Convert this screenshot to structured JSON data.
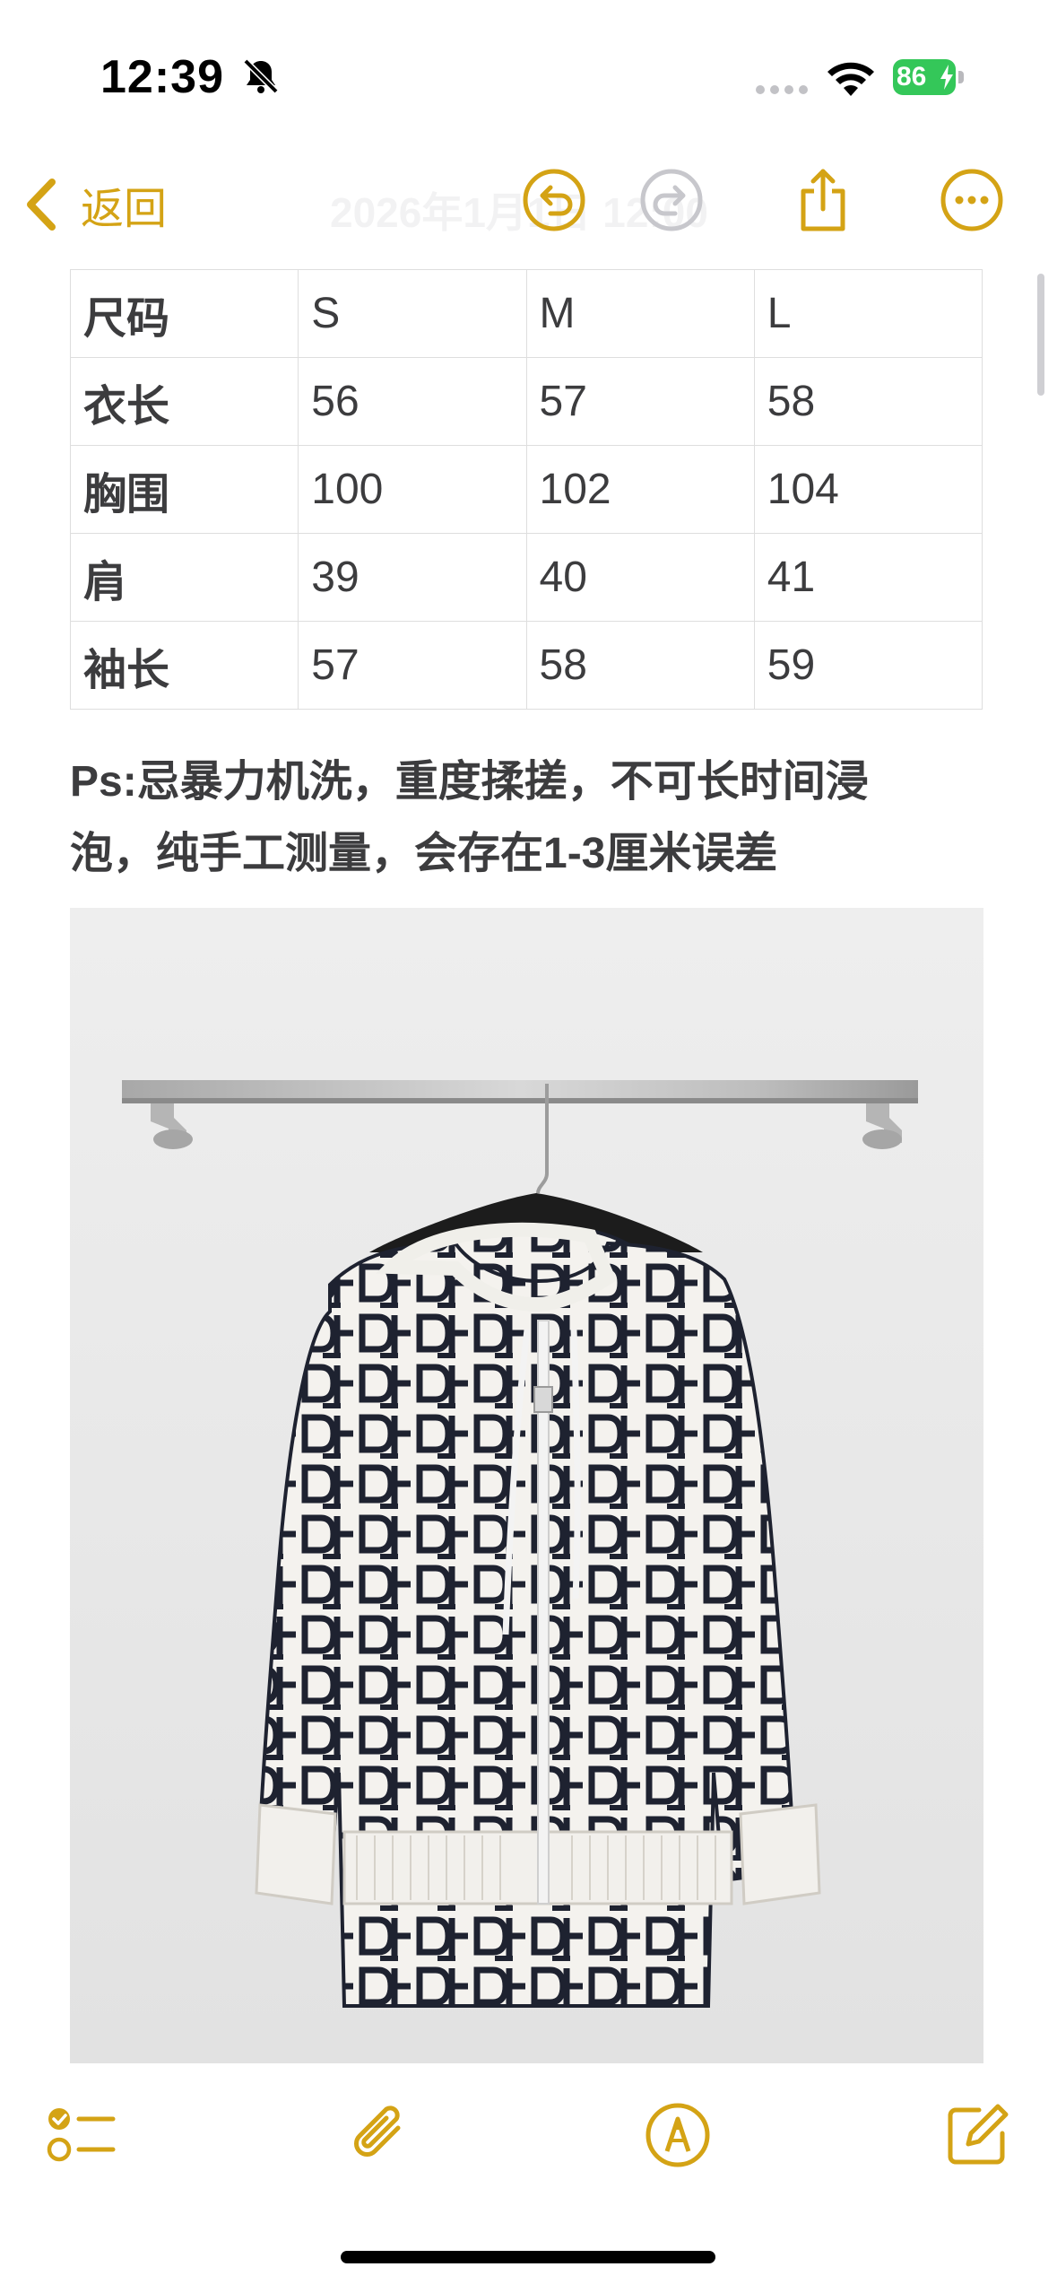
{
  "status_bar": {
    "time": "12:39",
    "battery_percent": "86",
    "icons": [
      "bell-slash-icon",
      "cellular-dots-icon",
      "wifi-icon",
      "battery-charging-icon"
    ]
  },
  "nav": {
    "back_label": "返回",
    "title_faded": "2026年1月1日 12:00",
    "buttons": [
      "undo-icon",
      "redo-icon",
      "share-icon",
      "more-icon"
    ]
  },
  "size_table": {
    "rows": [
      [
        "尺码",
        "S",
        "M",
        "L"
      ],
      [
        "衣长",
        "56",
        "57",
        "58"
      ],
      [
        "胸围",
        "100",
        "102",
        "104"
      ],
      [
        "肩",
        "39",
        "40",
        "41"
      ],
      [
        "袖长",
        "57",
        "58",
        "59"
      ]
    ]
  },
  "note": {
    "line1": "Ps:忌暴力机洗，重度揉搓，不可长时间浸",
    "line2": "泡，纯手工测量，会存在1-3厘米误差"
  },
  "toolbar": {
    "buttons": [
      "checklist-icon",
      "paperclip-icon",
      "markup-pen-icon",
      "compose-icon"
    ]
  },
  "colors": {
    "accent": "#d4a315",
    "disabled": "#c7c7cc",
    "battery_green": "#34c759"
  }
}
